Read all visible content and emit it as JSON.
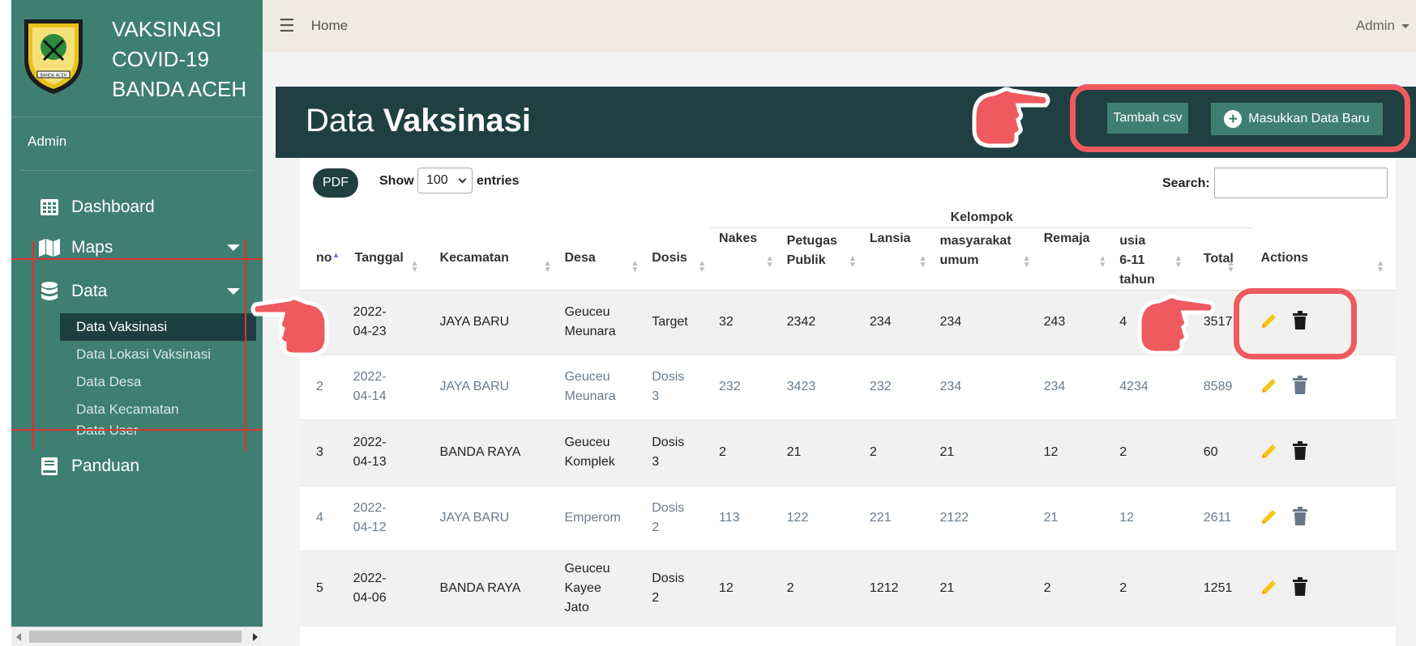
{
  "sidebar": {
    "brand_lines": [
      "VAKSINASI",
      "COVID-19",
      "BANDA ACEH"
    ],
    "logo_text": "BANDA ACEH",
    "user": "Admin",
    "nav": {
      "dashboard": "Dashboard",
      "maps": "Maps",
      "data": "Data",
      "panduan": "Panduan"
    },
    "sub_items": [
      "Data Vaksinasi",
      "Data Lokasi Vaksinasi",
      "Data Desa",
      "Data Kecamatan",
      "Data User"
    ]
  },
  "topbar": {
    "home": "Home",
    "admin": "Admin"
  },
  "header": {
    "title_light": "Data ",
    "title_bold": "Vaksinasi",
    "csv_button": "Tambah csv",
    "new_button": "Masukkan Data Baru"
  },
  "controls": {
    "pdf": "PDF",
    "show": "Show",
    "entries_value": "100",
    "entries": "entries",
    "search_label": "Search:",
    "search_value": ""
  },
  "table": {
    "group_header": "Kelompok",
    "columns": {
      "no": "no",
      "tanggal": "Tanggal",
      "kecamatan": "Kecamatan",
      "desa": "Desa",
      "dosis": "Dosis",
      "nakes": "Nakes",
      "petugas": "Petugas Publik",
      "lansia": "Lansia",
      "masyarakat": "masyarakat umum",
      "remaja": "Remaja",
      "usia": "usia 6-11 tahun",
      "total": "Total",
      "actions": "Actions"
    },
    "rows": [
      {
        "no": "",
        "tanggal": "2022-04-23",
        "kecamatan": "JAYA BARU",
        "desa": "Geuceu Meunara",
        "dosis": "Target",
        "nakes": "32",
        "petugas": "2342",
        "lansia": "234",
        "masyarakat": "234",
        "remaja": "243",
        "usia": "4",
        "total": "3517"
      },
      {
        "no": "2",
        "tanggal": "2022-04-14",
        "kecamatan": "JAYA BARU",
        "desa": "Geuceu Meunara",
        "dosis": "Dosis 3",
        "nakes": "232",
        "petugas": "3423",
        "lansia": "232",
        "masyarakat": "234",
        "remaja": "234",
        "usia": "4234",
        "total": "8589"
      },
      {
        "no": "3",
        "tanggal": "2022-04-13",
        "kecamatan": "BANDA RAYA",
        "desa": "Geuceu Komplek",
        "dosis": "Dosis 3",
        "nakes": "2",
        "petugas": "21",
        "lansia": "2",
        "masyarakat": "21",
        "remaja": "12",
        "usia": "2",
        "total": "60"
      },
      {
        "no": "4",
        "tanggal": "2022-04-12",
        "kecamatan": "JAYA BARU",
        "desa": "Emperom",
        "dosis": "Dosis 2",
        "nakes": "113",
        "petugas": "122",
        "lansia": "221",
        "masyarakat": "2122",
        "remaja": "21",
        "usia": "12",
        "total": "2611"
      },
      {
        "no": "5",
        "tanggal": "2022-04-06",
        "kecamatan": "BANDA RAYA",
        "desa": "Geuceu Kayee Jato",
        "dosis": "Dosis 2",
        "nakes": "12",
        "petugas": "2",
        "lansia": "1212",
        "masyarakat": "21",
        "remaja": "2",
        "usia": "2",
        "total": "1251"
      }
    ]
  },
  "colors": {
    "sidebar": "#3f7f72",
    "dark": "#1f3f43",
    "highlight": "#ef5a5e",
    "pencil": "#f5c518"
  },
  "icons": [
    "logo-emblem",
    "table-icon",
    "map-icon",
    "database-icon",
    "book-icon",
    "bars-icon",
    "plus-circle-icon",
    "pencil-icon",
    "trash-icon",
    "pointing-hand-icon"
  ]
}
